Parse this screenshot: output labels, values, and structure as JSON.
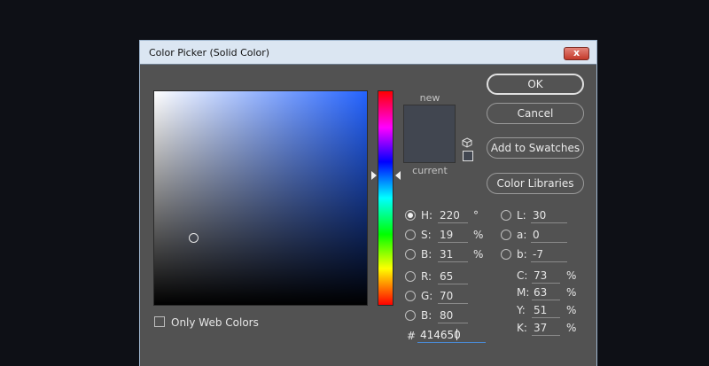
{
  "window": {
    "title": "Color Picker (Solid Color)",
    "close_label": "x"
  },
  "preview": {
    "new_label": "new",
    "current_label": "current",
    "new_color": "#414650",
    "current_color": "#414650"
  },
  "buttons": {
    "ok": "OK",
    "cancel": "Cancel",
    "add_to_swatches": "Add to Swatches",
    "color_libraries": "Color Libraries"
  },
  "only_web_colors": {
    "label": "Only Web Colors",
    "checked": false
  },
  "hsb": {
    "h": {
      "label": "H:",
      "value": "220",
      "unit": "°",
      "selected": true
    },
    "s": {
      "label": "S:",
      "value": "19",
      "unit": "%"
    },
    "b": {
      "label": "B:",
      "value": "31",
      "unit": "%"
    }
  },
  "rgb": {
    "r": {
      "label": "R:",
      "value": "65"
    },
    "g": {
      "label": "G:",
      "value": "70"
    },
    "b": {
      "label": "B:",
      "value": "80"
    }
  },
  "lab": {
    "l": {
      "label": "L:",
      "value": "30"
    },
    "a": {
      "label": "a:",
      "value": "0"
    },
    "b": {
      "label": "b:",
      "value": "-7"
    }
  },
  "cmyk": {
    "c": {
      "label": "C:",
      "value": "73",
      "unit": "%"
    },
    "m": {
      "label": "M:",
      "value": "63",
      "unit": "%"
    },
    "y": {
      "label": "Y:",
      "value": "51",
      "unit": "%"
    },
    "k": {
      "label": "K:",
      "value": "37",
      "unit": "%"
    }
  },
  "hex": {
    "label": "#",
    "value": "414650"
  },
  "colors": {
    "field_hue": "#2463ff",
    "accent": "#4a8ad4"
  }
}
